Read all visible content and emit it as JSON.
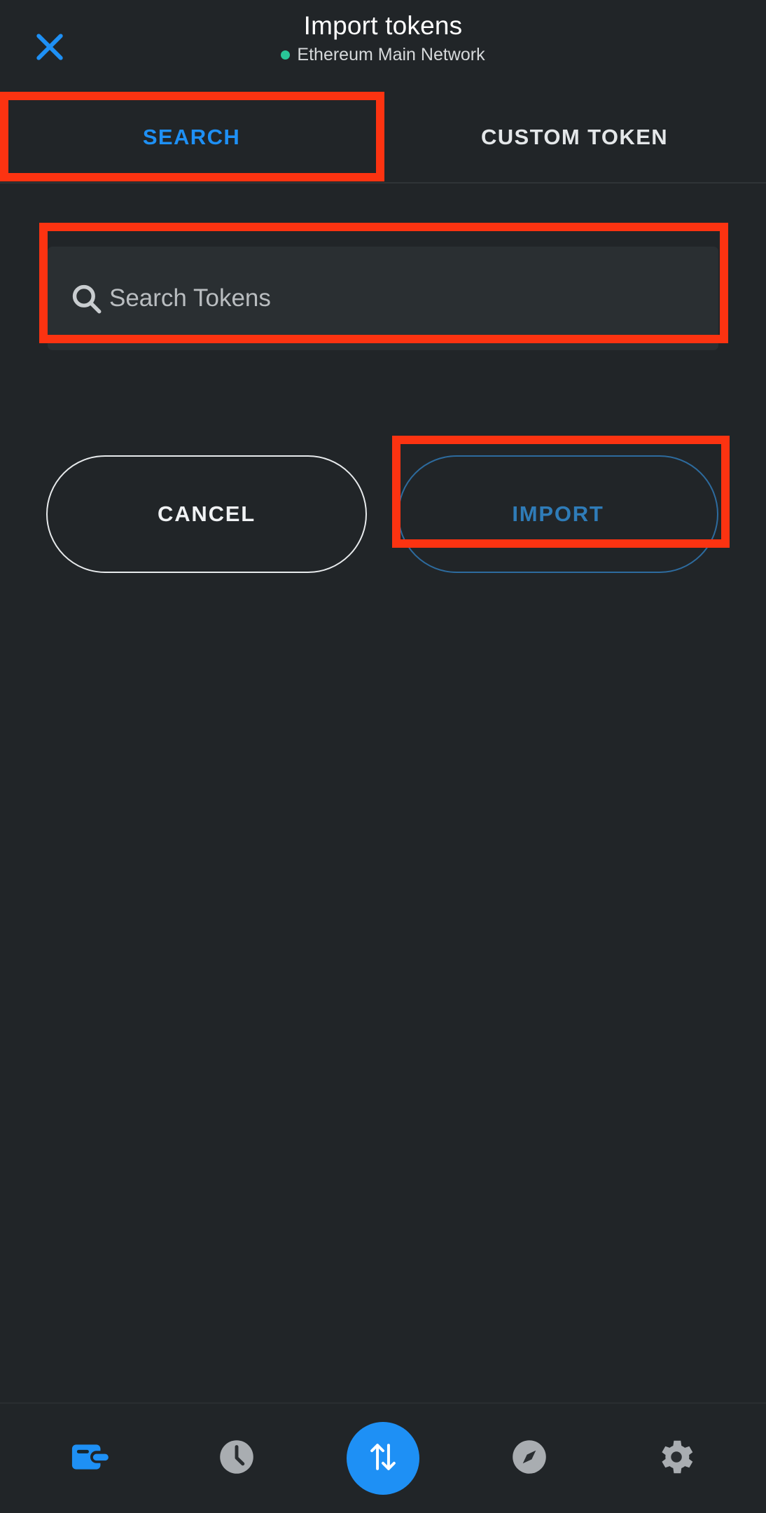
{
  "app": {
    "background_color": "#212528",
    "accent_color": "#1e90f5",
    "highlight_color": "#fc3311",
    "network_dot_color": "#29c698"
  },
  "header": {
    "title": "Import tokens",
    "network_label": "Ethereum Main Network",
    "close_icon": "close-icon"
  },
  "tabs": [
    {
      "label": "SEARCH",
      "active": true
    },
    {
      "label": "CUSTOM TOKEN",
      "active": false
    }
  ],
  "search": {
    "icon": "search-icon",
    "placeholder": "Search Tokens",
    "value": ""
  },
  "actions": {
    "cancel_label": "CANCEL",
    "import_label": "IMPORT",
    "import_disabled": true
  },
  "bottom_nav": [
    {
      "icon": "wallet-icon",
      "active": true
    },
    {
      "icon": "clock-icon",
      "active": false
    },
    {
      "icon": "swap-icon",
      "active": true
    },
    {
      "icon": "compass-icon",
      "active": false
    },
    {
      "icon": "gear-icon",
      "active": false
    }
  ]
}
